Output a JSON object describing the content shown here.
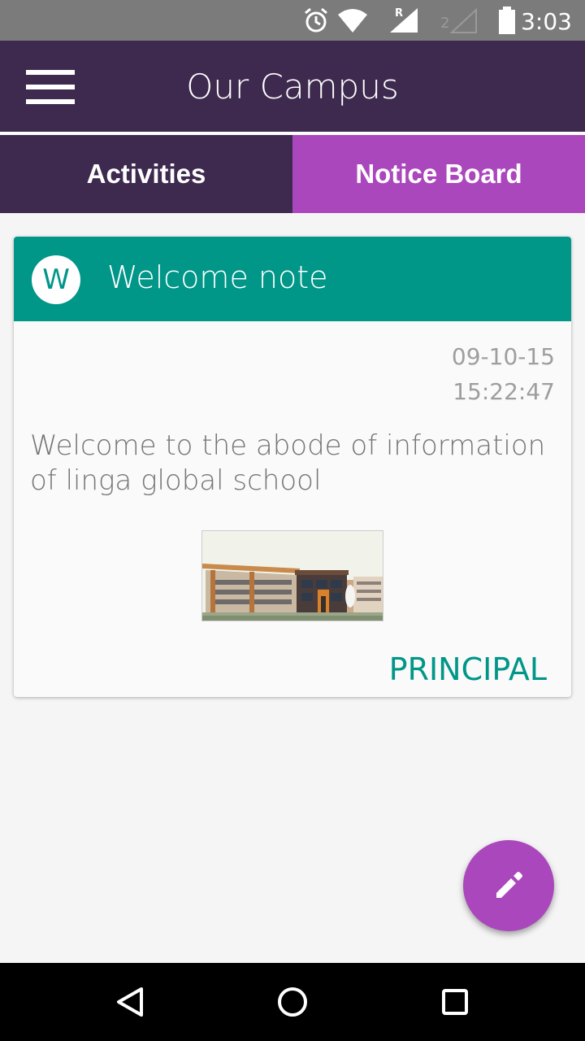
{
  "status_bar": {
    "time": "3:03",
    "icons": [
      "alarm-icon",
      "wifi-icon",
      "signal-roaming-icon",
      "signal-sim2-icon",
      "battery-icon"
    ]
  },
  "app_bar": {
    "title": "Our Campus",
    "menu_icon": "hamburger-menu-icon"
  },
  "tabs": [
    {
      "label": "Activities",
      "active": false
    },
    {
      "label": "Notice Board",
      "active": true
    }
  ],
  "notice": {
    "avatar_letter": "W",
    "title": "Welcome note",
    "date": "09-10-15",
    "time": "15:22:47",
    "body": "Welcome to the abode of information of linga global school",
    "author": "PRINCIPAL"
  },
  "fab": {
    "icon": "pencil-icon"
  },
  "nav_bar": {
    "icons": [
      "back-icon",
      "home-icon",
      "recents-icon"
    ]
  },
  "colors": {
    "primary_dark": "#3e2a4e",
    "accent": "#ab47bc",
    "teal": "#009688"
  }
}
